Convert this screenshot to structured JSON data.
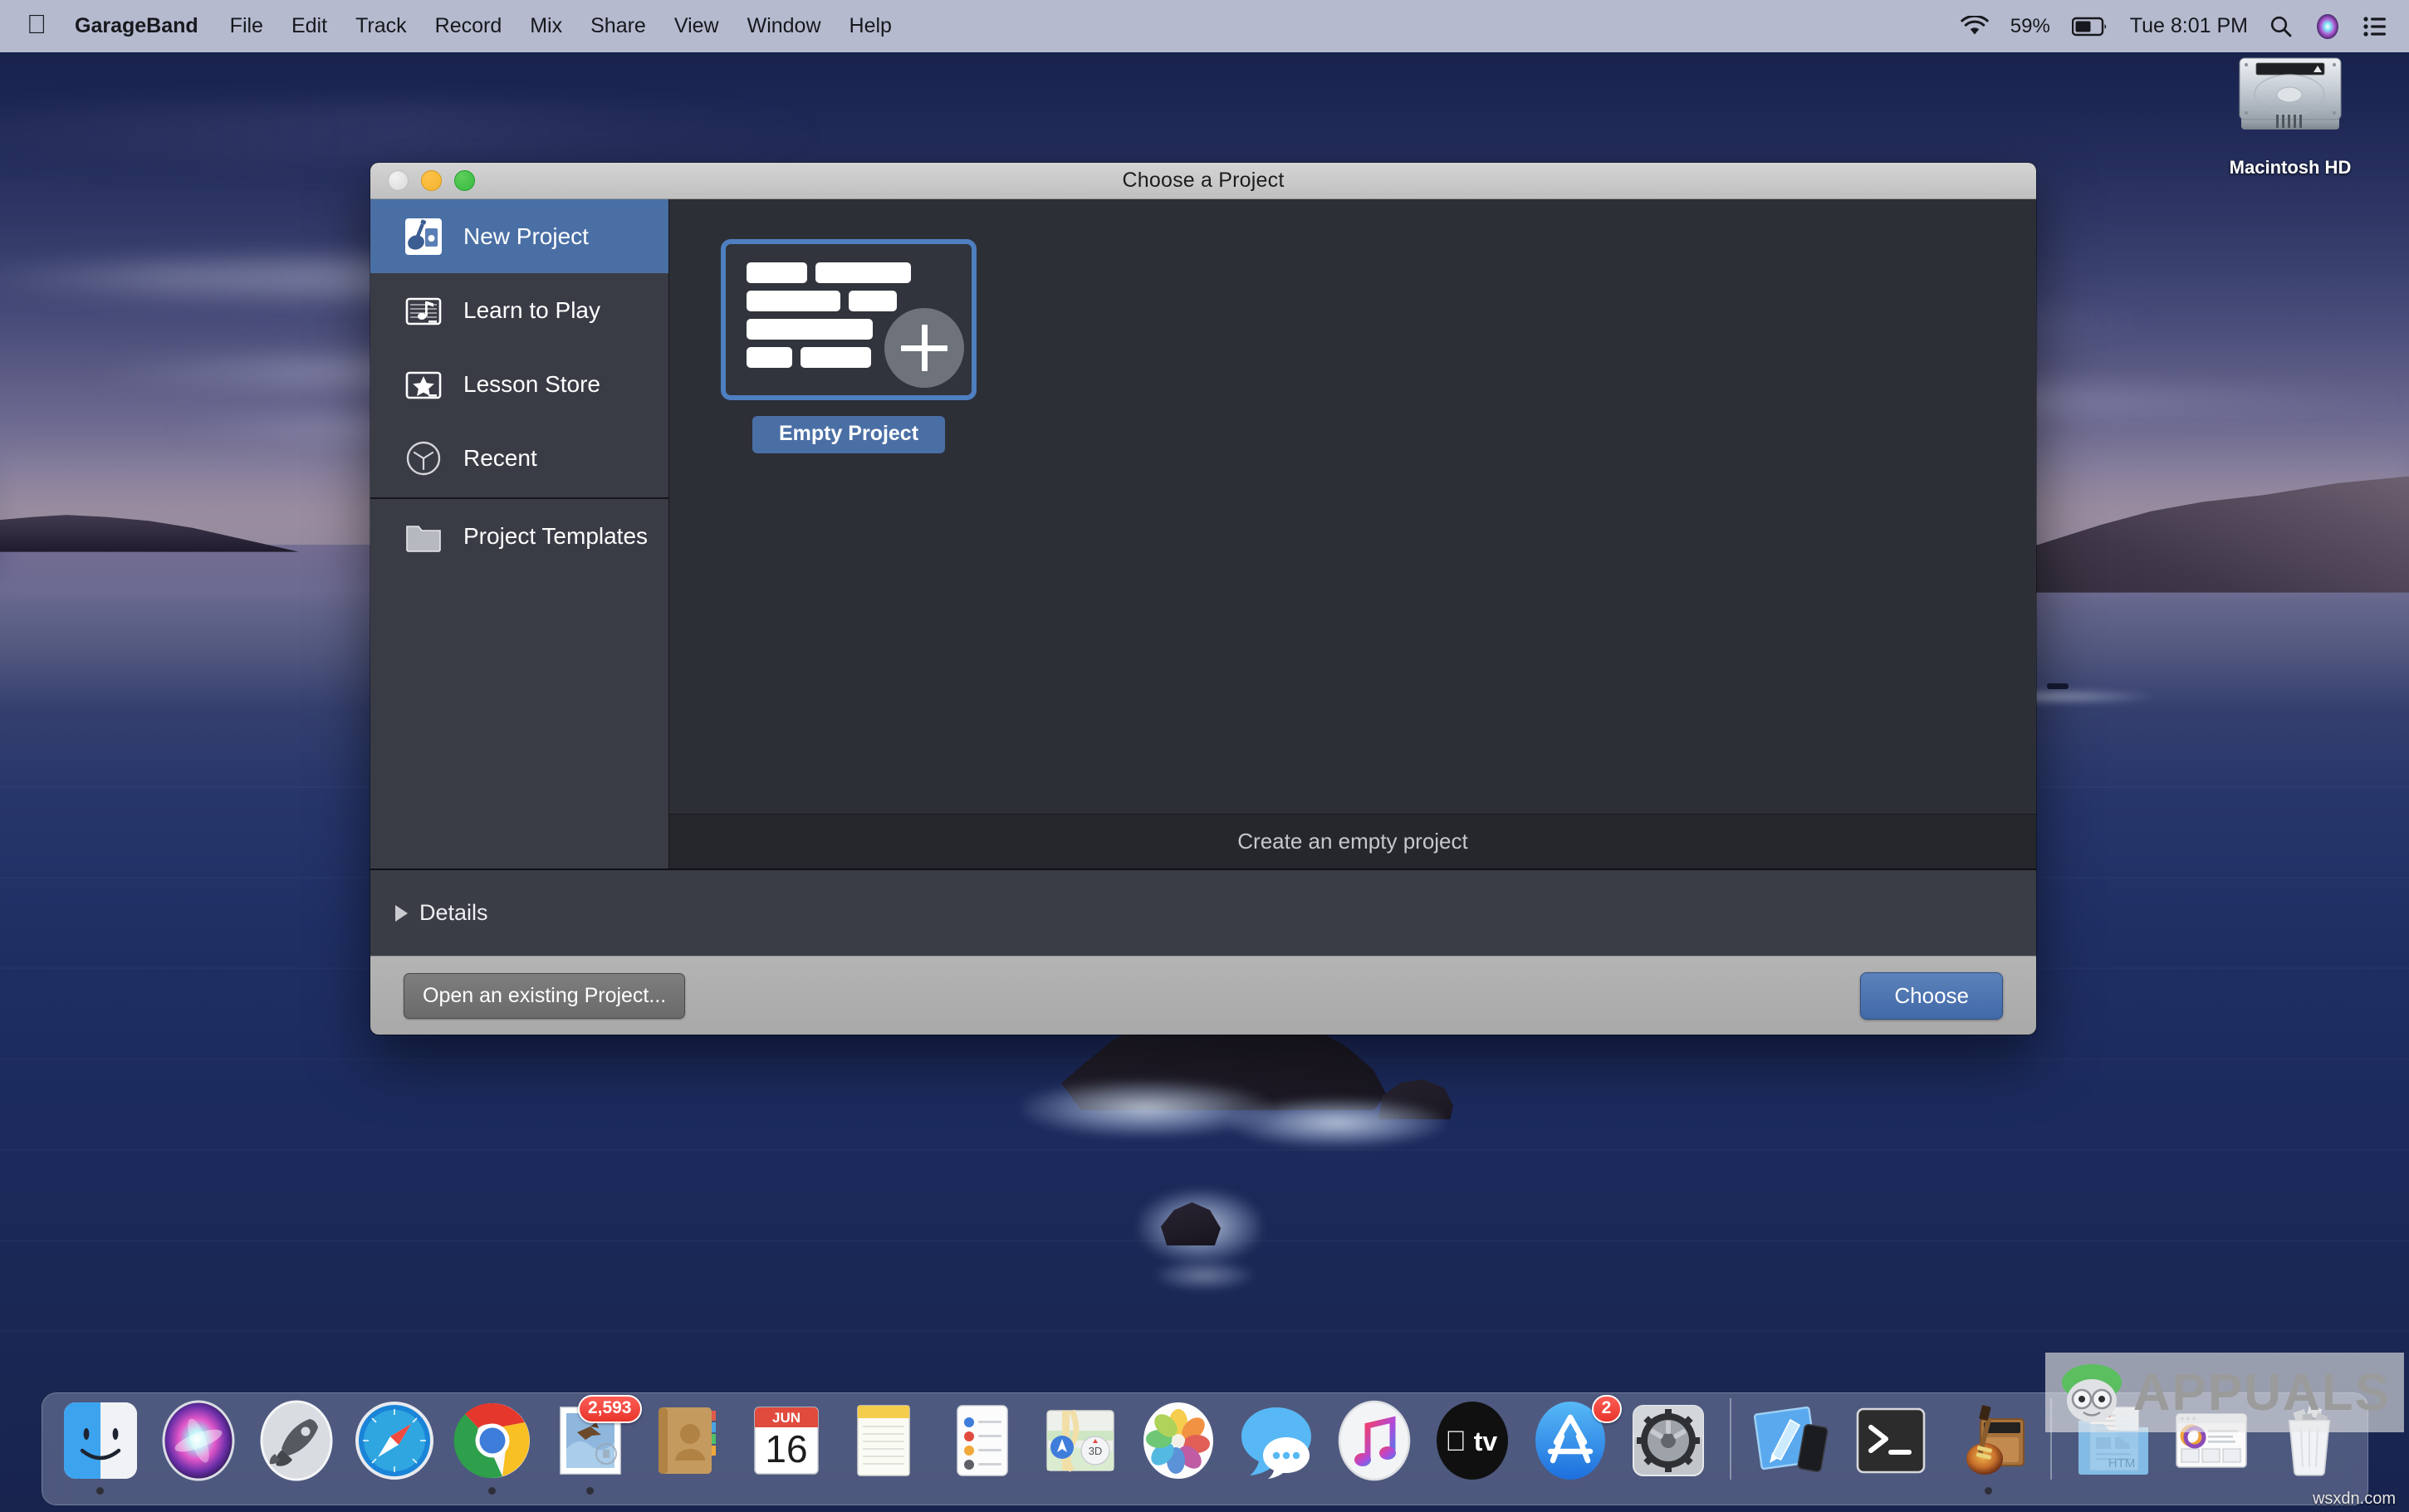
{
  "menubar": {
    "apple_logo": "apple-logo",
    "items": [
      {
        "label": "GarageBand",
        "name": "menu-garageband",
        "bold": true
      },
      {
        "label": "File",
        "name": "menu-file"
      },
      {
        "label": "Edit",
        "name": "menu-edit"
      },
      {
        "label": "Track",
        "name": "menu-track"
      },
      {
        "label": "Record",
        "name": "menu-record"
      },
      {
        "label": "Mix",
        "name": "menu-mix"
      },
      {
        "label": "Share",
        "name": "menu-share"
      },
      {
        "label": "View",
        "name": "menu-view"
      },
      {
        "label": "Window",
        "name": "menu-window"
      },
      {
        "label": "Help",
        "name": "menu-help"
      }
    ],
    "status": {
      "wifi_icon": "wifi-icon",
      "battery_percent": "59%",
      "battery_icon": "battery-icon",
      "clock": "Tue 8:01 PM",
      "search_icon": "search-icon",
      "siri_icon": "siri-icon",
      "control_center_icon": "control-center-icon"
    }
  },
  "desktop": {
    "hard_drive": {
      "label": "Macintosh HD",
      "icon": "hard-drive-icon"
    }
  },
  "window": {
    "title": "Choose a Project",
    "traffic_lights": {
      "close": "close-button",
      "minimize": "minimize-button",
      "maximize": "maximize-button"
    },
    "sidebar": {
      "items": [
        {
          "label": "New Project",
          "icon": "guitar-amp-icon",
          "selected": true
        },
        {
          "label": "Learn to Play",
          "icon": "music-staff-icon",
          "selected": false
        },
        {
          "label": "Lesson Store",
          "icon": "star-icon",
          "selected": false
        },
        {
          "label": "Recent",
          "icon": "clock-icon",
          "selected": false
        },
        {
          "label": "Project Templates",
          "icon": "folder-icon",
          "selected": false
        }
      ]
    },
    "templates": [
      {
        "label": "Empty Project",
        "selected": true,
        "icon": "empty-project-icon"
      }
    ],
    "status_text": "Create an empty project",
    "details": {
      "label": "Details",
      "expanded": false,
      "disclosure_icon": "disclosure-triangle-right-icon"
    },
    "footer": {
      "open_existing_label": "Open an existing Project...",
      "choose_label": "Choose"
    },
    "colors": {
      "selection_blue": "#4a6fa5",
      "panel_dark": "#2d2f36",
      "sidebar_dark": "#393c45",
      "titlebar_gray": "#c8c8c8"
    }
  },
  "dock": {
    "items": [
      {
        "name": "finder",
        "label": "Finder",
        "running": true
      },
      {
        "name": "siri",
        "label": "Siri",
        "running": false
      },
      {
        "name": "launchpad",
        "label": "Launchpad",
        "running": false
      },
      {
        "name": "safari",
        "label": "Safari",
        "running": false
      },
      {
        "name": "chrome",
        "label": "Google Chrome",
        "running": true
      },
      {
        "name": "mail",
        "label": "Mail",
        "running": true,
        "badge": "2,593"
      },
      {
        "name": "contacts",
        "label": "Contacts",
        "running": false
      },
      {
        "name": "calendar",
        "label": "Calendar",
        "running": false,
        "month": "JUN",
        "day": "16"
      },
      {
        "name": "notes",
        "label": "Notes",
        "running": false
      },
      {
        "name": "reminders",
        "label": "Reminders",
        "running": false
      },
      {
        "name": "maps",
        "label": "Maps",
        "running": false,
        "badge_text": "3D"
      },
      {
        "name": "photos",
        "label": "Photos",
        "running": false
      },
      {
        "name": "messages",
        "label": "Messages",
        "running": false
      },
      {
        "name": "music",
        "label": "Music",
        "running": false
      },
      {
        "name": "appletv",
        "label": "Apple TV",
        "running": false
      },
      {
        "name": "appstore",
        "label": "App Store",
        "running": false,
        "badge": "2"
      },
      {
        "name": "system-preferences",
        "label": "System Preferences",
        "running": false
      },
      {
        "name": "separator-1",
        "label": "",
        "separator": true
      },
      {
        "name": "xcode",
        "label": "Xcode",
        "running": false
      },
      {
        "name": "terminal",
        "label": "Terminal",
        "running": false
      },
      {
        "name": "garageband",
        "label": "GarageBand",
        "running": true
      },
      {
        "name": "separator-2",
        "label": "",
        "separator": true
      },
      {
        "name": "downloads-stack",
        "label": "Downloads",
        "running": false,
        "file_label": "HTM"
      },
      {
        "name": "documents-stack",
        "label": "Documents",
        "running": false
      },
      {
        "name": "trash",
        "label": "Trash",
        "running": false
      }
    ]
  },
  "watermark": {
    "text": "APPUALS",
    "site": "wsxdn.com"
  }
}
